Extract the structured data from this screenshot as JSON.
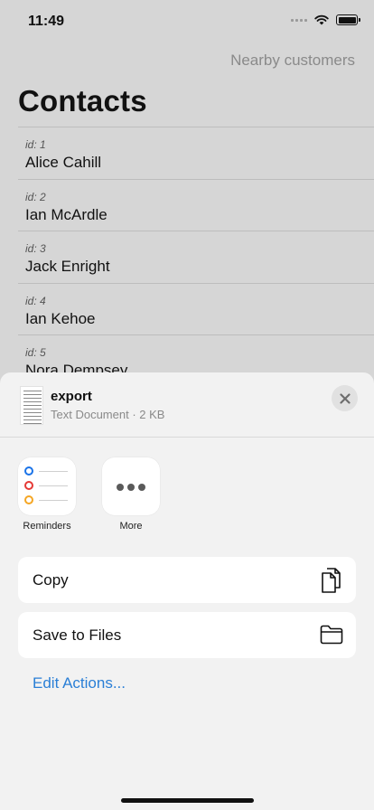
{
  "status_bar": {
    "time": "11:49"
  },
  "nav": {
    "right_button": "Nearby customers",
    "title": "Contacts"
  },
  "contacts": [
    {
      "id": "id: 1",
      "name": "Alice Cahill"
    },
    {
      "id": "id: 2",
      "name": "Ian McArdle"
    },
    {
      "id": "id: 3",
      "name": "Jack Enright"
    },
    {
      "id": "id: 4",
      "name": "Ian Kehoe"
    },
    {
      "id": "id: 5",
      "name": "Nora Dempsey"
    }
  ],
  "share_sheet": {
    "file_name": "export",
    "file_info": "Text Document · 2 KB",
    "apps": [
      {
        "label": "Reminders",
        "icon": "reminders-icon"
      },
      {
        "label": "More",
        "icon": "more-icon"
      }
    ],
    "actions": [
      {
        "label": "Copy",
        "icon": "copy-icon"
      },
      {
        "label": "Save to Files",
        "icon": "folder-icon"
      }
    ],
    "edit_actions": "Edit Actions..."
  },
  "colors": {
    "accent": "#2a7fd6",
    "sheet_bg": "#f2f2f2",
    "dim_bg": "#d6d6d6"
  }
}
